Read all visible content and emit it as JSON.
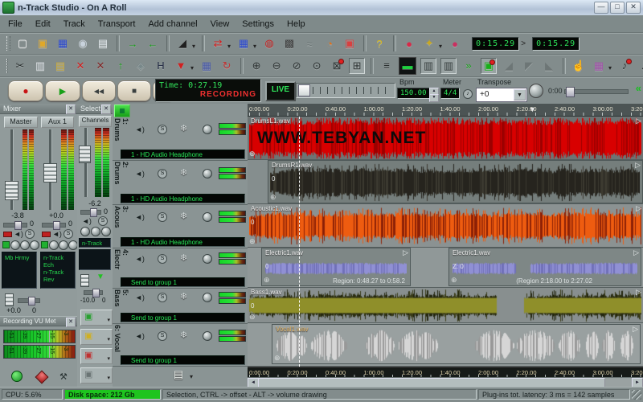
{
  "window": {
    "title": "n-Track Studio - On A Roll"
  },
  "menu": [
    "File",
    "Edit",
    "Track",
    "Transport",
    "Add channel",
    "View",
    "Settings",
    "Help"
  ],
  "toolbar1": {
    "items": [
      {
        "name": "new-song-icon",
        "glyph": "▢",
        "color": "#f4f4f4"
      },
      {
        "name": "open-song-icon",
        "glyph": "▣",
        "color": "#e0a828"
      },
      {
        "name": "save-song-icon",
        "glyph": "▦",
        "color": "#2846d0"
      },
      {
        "name": "burn-cd-icon",
        "glyph": "◉",
        "color": "#c8d2dc"
      },
      {
        "name": "song-overview-icon",
        "glyph": "▤",
        "color": "#dce2e6"
      },
      {
        "sep": true
      },
      {
        "name": "import-wav-icon",
        "glyph": "→",
        "color": "#18a018"
      },
      {
        "name": "export-wav-icon",
        "glyph": "←",
        "color": "#18a018"
      },
      {
        "sep": true
      },
      {
        "name": "volume-draw-icon",
        "glyph": "◢",
        "color": "#202020",
        "dd": true
      },
      {
        "sep": true
      },
      {
        "name": "loop-icon",
        "glyph": "⇄",
        "color": "#d02020",
        "dd": true
      },
      {
        "name": "mixdown-icon",
        "glyph": "▦",
        "color": "#2846d0",
        "dd": true
      },
      {
        "name": "vu-meter-window-icon",
        "glyph": "◍",
        "color": "#c02020"
      },
      {
        "name": "video-window-icon",
        "glyph": "▩",
        "color": "#383838"
      },
      {
        "name": "cables-icon",
        "glyph": "≈",
        "color": "#6a7474"
      },
      {
        "name": "metronome-icon",
        "glyph": "◔",
        "color": "#e07018"
      },
      {
        "name": "sync-icon",
        "glyph": "▣",
        "color": "#d84040"
      },
      {
        "sep": true
      },
      {
        "name": "help-icon",
        "glyph": "?",
        "color": "#d8b818"
      },
      {
        "sep": true
      },
      {
        "name": "punch-in-marker-icon",
        "glyph": "●",
        "color": "#d82848"
      },
      {
        "name": "key-shortcut-icon",
        "glyph": "✦",
        "color": "#c8a820",
        "dd": true
      },
      {
        "name": "punch-out-marker-icon",
        "glyph": "●",
        "color": "#c83060"
      }
    ],
    "punch_in": "0:15.29",
    "arrow": ">",
    "punch_out": "0:15.29"
  },
  "toolbar2": {
    "items": [
      {
        "name": "cut-icon",
        "glyph": "✂",
        "color": "#2a3030"
      },
      {
        "name": "copy-icon",
        "glyph": "▥",
        "color": "#d8dce0"
      },
      {
        "name": "paste-icon",
        "glyph": "▤",
        "color": "#c8a838"
      },
      {
        "name": "delete-icon",
        "glyph": "✕",
        "color": "#d02020"
      },
      {
        "name": "remove-track-icon",
        "glyph": "✕",
        "color": "#802828"
      },
      {
        "name": "insert-track-icon",
        "glyph": "↑",
        "color": "#18a018"
      },
      {
        "name": "anchor-icon",
        "glyph": "◈",
        "color": "#78888a"
      },
      {
        "name": "marker-tool-icon",
        "glyph": "H",
        "color": "#283048"
      },
      {
        "name": "draw-tool-icon",
        "glyph": "▼",
        "color": "#d02020",
        "dd": true
      },
      {
        "name": "grid-snap-icon",
        "glyph": "▦",
        "color": "#4858a8"
      },
      {
        "name": "loop-play-icon",
        "glyph": "↻",
        "color": "#c03030"
      },
      {
        "sep": true
      },
      {
        "name": "zoom-in-icon",
        "glyph": "⊕",
        "color": "#2a3030"
      },
      {
        "name": "zoom-out-icon",
        "glyph": "⊖",
        "color": "#2a3030"
      },
      {
        "name": "zoom-horizontal-icon",
        "glyph": "⊘",
        "color": "#2a3030"
      },
      {
        "name": "zoom-vertical-icon",
        "glyph": "⊙",
        "color": "#2a3030"
      },
      {
        "name": "zoom-selection-icon",
        "glyph": "⊠",
        "color": "#2a3030",
        "dot": true
      },
      {
        "name": "zoom-all-icon",
        "glyph": "⊞",
        "color": "#2a3030",
        "pressed": true
      },
      {
        "sep": true
      },
      {
        "name": "track-list-icon",
        "glyph": "≡",
        "color": "#1a2020"
      },
      {
        "name": "big-time-display-icon",
        "glyph": "▬",
        "color": "#20d040",
        "dark": true
      },
      {
        "name": "show-mixer-icon",
        "glyph": "▥",
        "color": "#303838",
        "pressed": true
      },
      {
        "name": "show-meters-icon",
        "glyph": "▥",
        "color": "#303838",
        "pressed": true
      },
      {
        "name": "goto-start-icon",
        "glyph": "»",
        "color": "#18a018"
      },
      {
        "name": "live-monitor-icon",
        "glyph": "▣",
        "color": "#18b018",
        "pressed": true,
        "dot": true
      },
      {
        "name": "fade-in-icon",
        "glyph": "◢",
        "color": "#6d7676"
      },
      {
        "name": "crossfade-icon",
        "glyph": "◤",
        "color": "#6d7676"
      },
      {
        "name": "fade-out-icon",
        "glyph": "◣",
        "color": "#6d7676"
      },
      {
        "sep": true
      },
      {
        "name": "hand-tool-icon",
        "glyph": "☝",
        "color": "#2a6a2a"
      },
      {
        "name": "piano-roll-icon",
        "glyph": "▦",
        "color": "#a050a8",
        "dd": true
      },
      {
        "name": "midi-output-icon",
        "glyph": "♪",
        "color": "#2a3030",
        "dot": true
      },
      {
        "name": "audio-output-icon",
        "glyph": "♫",
        "color": "#2a3030",
        "dot": true
      }
    ]
  },
  "transport": {
    "buttons": [
      {
        "name": "record-button",
        "glyph": "●",
        "color": "#c81414"
      },
      {
        "name": "play-button",
        "glyph": "▶",
        "color": "#18a018"
      },
      {
        "name": "rewind-button",
        "glyph": "◀◀",
        "color": "#3a4040"
      },
      {
        "name": "stop-button",
        "glyph": "■",
        "color": "#3a4040"
      },
      {
        "name": "pause-button",
        "glyph": "Ⅱ",
        "color": "#3a4040"
      }
    ],
    "time_label": "Time: 0:27.19",
    "recording_label": "RECORDING",
    "live_label": "LIVE",
    "bpm_label": "Bpm",
    "bpm_value": "150.00",
    "meter_label": "Meter",
    "meter_value": "4/4",
    "note_glyph": "♪",
    "transpose_label": "Transpose",
    "transpose_value": "+0",
    "offset_value": "0:00"
  },
  "mixer": {
    "title": "Mixer",
    "channels": [
      {
        "name": "Master",
        "db": "-3.8",
        "pan": "0"
      },
      {
        "name": "Aux 1",
        "db": "+0.0",
        "pan": "0"
      }
    ],
    "solo_glyph": "S",
    "speaker_glyph": "◄)",
    "fx_master": [
      "Mb Hrmy"
    ],
    "fx_aux": [
      "n-Track Ech",
      "n-Track Rev"
    ],
    "bottom_db": "+0.0",
    "bottom_pan": "0"
  },
  "selected": {
    "title": "Select..",
    "channels_label": "Channels",
    "db": "-6.2",
    "pan": "0",
    "fx": [
      "n-Track Cha"
    ],
    "out_db": "-10.0",
    "out_pan": "0",
    "inserts": [
      {
        "name": "insert-slot-1-button",
        "glyph": "▣",
        "color": "#28a030"
      },
      {
        "name": "insert-slot-2-button",
        "glyph": "▣",
        "color": "#d0b020"
      },
      {
        "name": "insert-slot-3-button",
        "glyph": "▣",
        "color": "#c03030"
      },
      {
        "name": "insert-slot-4-button",
        "glyph": "▣",
        "color": "#6a7474"
      }
    ]
  },
  "recording_vu": {
    "title": "Recording VU Met",
    "scale": [
      "-51",
      "-39",
      "-27",
      "-15",
      "-3"
    ]
  },
  "strip": {
    "speaker_glyph": "◄)",
    "solo_glyph": "S",
    "freeze_glyph": "❄",
    "master_glyph": "▤",
    "tracks": [
      {
        "label": "1: Drums",
        "output": "1 - HD Audio Headphone"
      },
      {
        "label": "2: Drums",
        "output": "1 - HD Audio Headphone"
      },
      {
        "label": "3: Acous",
        "output": "1 - HD Audio Headphone"
      },
      {
        "label": "4: Electr",
        "output": "Send to group 1"
      },
      {
        "label": "5: Bass",
        "output": "Send to group 1"
      },
      {
        "label": "6: Vocal",
        "output": "Send to group 1"
      }
    ]
  },
  "timeline": {
    "ticks": [
      "0:00.00",
      "0:20.00",
      "0:40.00",
      "1:00.00",
      "1:20.00",
      "1:40.00",
      "2:00.00",
      "2:20.00",
      "2:40.00",
      "3:00.00",
      "3:20.0"
    ]
  },
  "lanes": {
    "drumsL": {
      "name": "DrumsL1.wav",
      "watermark": "WWW.TEBYAN.NET"
    },
    "drumsR": {
      "name": "DrumsR1.wav",
      "gain": "0"
    },
    "acoustic": {
      "name": "Acoustic1.wav",
      "gain": "0"
    },
    "electric1": {
      "name": "Electric1.wav",
      "gain": "0",
      "region": "Region: 0:48.27 to 0:58.2"
    },
    "electric2": {
      "name": "Electric1.wav",
      "gain": "Z: 0",
      "region": "(Region 2:18.00 to 2:27.02"
    },
    "bass": {
      "name": "Bass1.wav",
      "gain": "0"
    },
    "vocal": {
      "name": "Vocal1.wav"
    }
  },
  "waves": {
    "drumsL": {
      "seed": 7,
      "color": "#d80000",
      "color2": "#9c0000",
      "base": 0.82,
      "var": 0.18,
      "amp": 0.97,
      "spiky": true
    },
    "drumsR": {
      "seed": 11,
      "color": "#26241e",
      "color2": "#3c3a30",
      "base": 0.5,
      "var": 0.5,
      "amp": 0.92,
      "spiky": true
    },
    "acoustic": {
      "seed": 13,
      "color": "#ee5c10",
      "color2": "#8c2006",
      "base": 0.45,
      "var": 0.5,
      "amp": 0.92,
      "spiky": true
    },
    "electric1": {
      "seed": 17,
      "color": "#9090d4",
      "color2": "#7070b8",
      "base": 0.62,
      "var": 0.18,
      "amp": 0.85
    },
    "electric2": {
      "seed": 19,
      "color": "#9090d4",
      "color2": "#7070b8",
      "base": 0.62,
      "var": 0.18,
      "amp": 0.85,
      "gaps": [
        [
          0.34,
          0.42
        ]
      ]
    },
    "bass": {
      "seed": 23,
      "color": "#23260f",
      "color2": "#3a3c18",
      "core": "#8f8f2a",
      "base": 0.42,
      "var": 0.55,
      "amp": 0.95,
      "spiky": true,
      "gaps": [
        [
          0.63,
          0.7
        ]
      ]
    },
    "vocal": {
      "seed": 29,
      "style": "blobs",
      "color": "#d6d6d6",
      "color2": "#989898",
      "amp": 0.92,
      "bursts": [
        [
          0.005,
          0.09
        ],
        [
          0.1,
          0.2
        ],
        [
          0.25,
          0.33
        ],
        [
          0.34,
          0.45
        ],
        [
          0.55,
          0.66
        ],
        [
          0.665,
          0.77
        ],
        [
          0.78,
          0.84
        ],
        [
          0.855,
          0.89
        ],
        [
          0.9,
          0.935
        ],
        [
          0.95,
          0.985
        ]
      ]
    }
  },
  "status": {
    "cpu": "CPU: 5.6%",
    "disk": "Disk space: 212 Gb",
    "selection": "Selection, CTRL -> offset - ALT -> volume drawing",
    "latency": "Plug-ins tot. latency: 3 ms = 142 samples"
  }
}
